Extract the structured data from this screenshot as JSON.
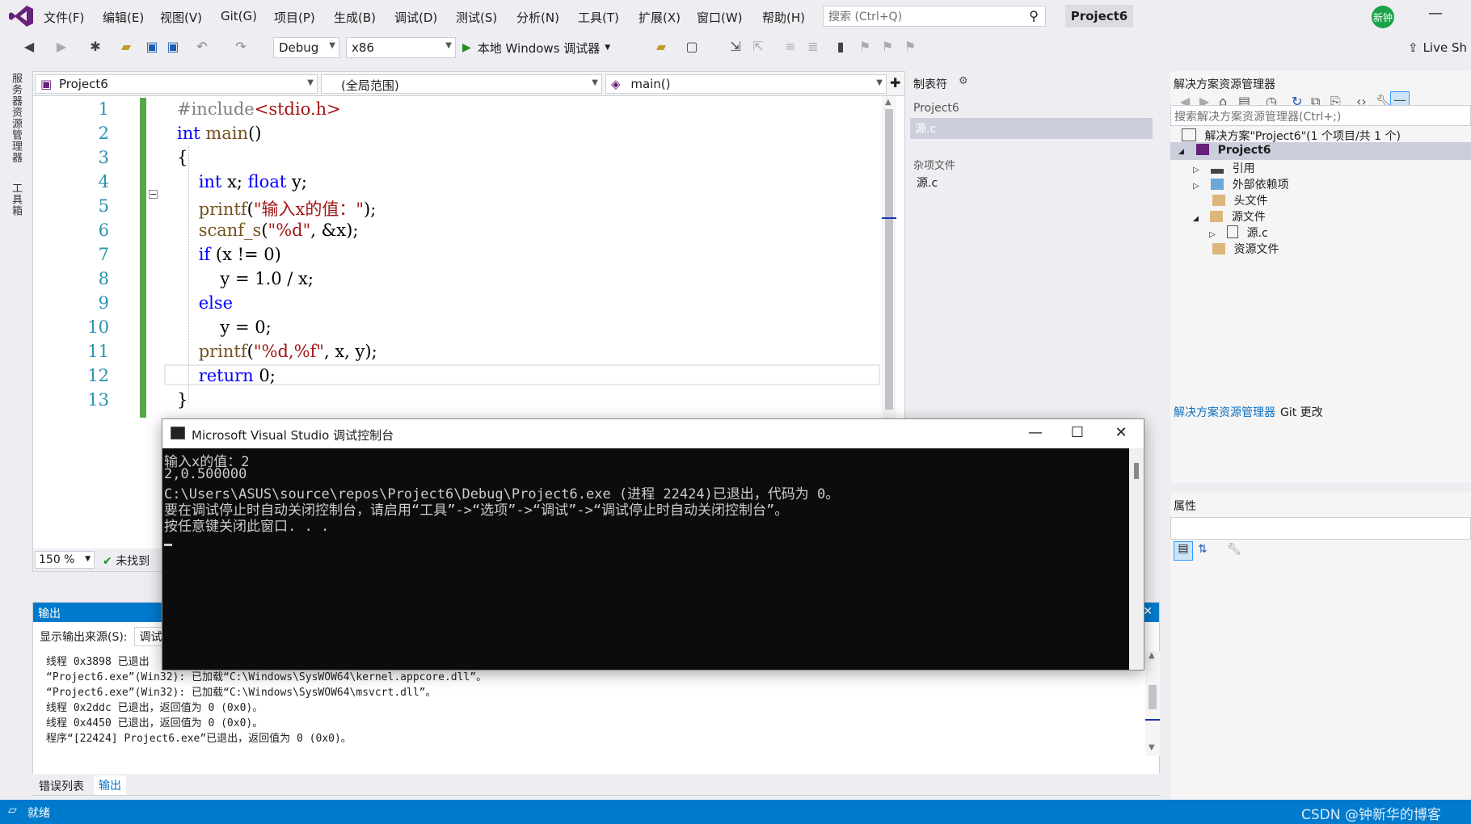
{
  "menubar": {
    "items": [
      "文件(F)",
      "编辑(E)",
      "视图(V)",
      "Git(G)",
      "项目(P)",
      "生成(B)",
      "调试(D)",
      "测试(S)",
      "分析(N)",
      "工具(T)",
      "扩展(X)",
      "窗口(W)",
      "帮助(H)"
    ],
    "search_placeholder": "搜索 (Ctrl+Q)",
    "project_name": "Project6",
    "avatar_text": "新钟",
    "minimize": "—"
  },
  "toolbar": {
    "config": "Debug",
    "platform": "x86",
    "run_label": "本地 Windows 调试器",
    "live_share": "Live Sh"
  },
  "left_strip": {
    "tab1": "服务器资源管理器",
    "tab2": "工具箱"
  },
  "editor": {
    "nav_project": "Project6",
    "nav_scope": "(全局范围)",
    "nav_function": "main()",
    "line_numbers": [
      "1",
      "2",
      "3",
      "4",
      "5",
      "6",
      "7",
      "8",
      "9",
      "10",
      "11",
      "12",
      "13"
    ],
    "code_lines": [
      "#include<stdio.h>",
      "int main()",
      "{",
      "    int x; float y;",
      "    printf(\"输入x的值：\");",
      "    scanf_s(\"%d\", &x);",
      "    if (x != 0)",
      "        y = 1.0 / x;",
      "    else",
      "        y = 0;",
      "    printf(\"%d,%f\", x, y);",
      "    return 0;",
      "}"
    ],
    "zoom": "150 %",
    "issues": "未找到"
  },
  "tabstops": {
    "title": "制表符",
    "project": "Project6",
    "file_selected": "源.c",
    "misc_header": "杂项文件",
    "misc_file": "源.c"
  },
  "solution_explorer": {
    "title": "解决方案资源管理器",
    "search_placeholder": "搜索解决方案资源管理器(Ctrl+;)",
    "solution": "解决方案\"Project6\"(1 个项目/共 1 个)",
    "project": "Project6",
    "items": [
      "引用",
      "外部依赖项",
      "头文件",
      "源文件",
      "源.c",
      "资源文件"
    ],
    "tab_active": "解决方案资源管理器",
    "tab_git": "Git 更改"
  },
  "properties": {
    "title": "属性"
  },
  "output": {
    "title": "输出",
    "source_label": "显示输出来源(S):",
    "source_value": "调试",
    "lines": [
      "线程 0x3898 已退出",
      "“Project6.exe”(Win32): 已加载“C:\\Windows\\SysWOW64\\kernel.appcore.dll”。",
      "“Project6.exe”(Win32): 已加载“C:\\Windows\\SysWOW64\\msvcrt.dll”。",
      "线程 0x2ddc 已退出，返回值为 0 (0x0)。",
      "线程 0x4450 已退出，返回值为 0 (0x0)。",
      "程序“[22424] Project6.exe”已退出，返回值为 0 (0x0)。"
    ],
    "tab_errors": "错误列表",
    "tab_output": "输出"
  },
  "statusbar": {
    "text": "就绪",
    "watermark": "CSDN @钟新华的博客"
  },
  "console": {
    "title": "Microsoft Visual Studio 调试控制台",
    "lines": [
      "输入x的值：2",
      "2,0.500000",
      "C:\\Users\\ASUS\\source\\repos\\Project6\\Debug\\Project6.exe (进程 22424)已退出，代码为 0。",
      "要在调试停止时自动关闭控制台，请启用“工具”->“选项”->“调试”->“调试停止时自动关闭控制台”。",
      "按任意键关闭此窗口. . ."
    ]
  },
  "colors": {
    "accent": "#007acc",
    "vs_purple": "#68217a",
    "run_green": "#1e8c2c"
  }
}
